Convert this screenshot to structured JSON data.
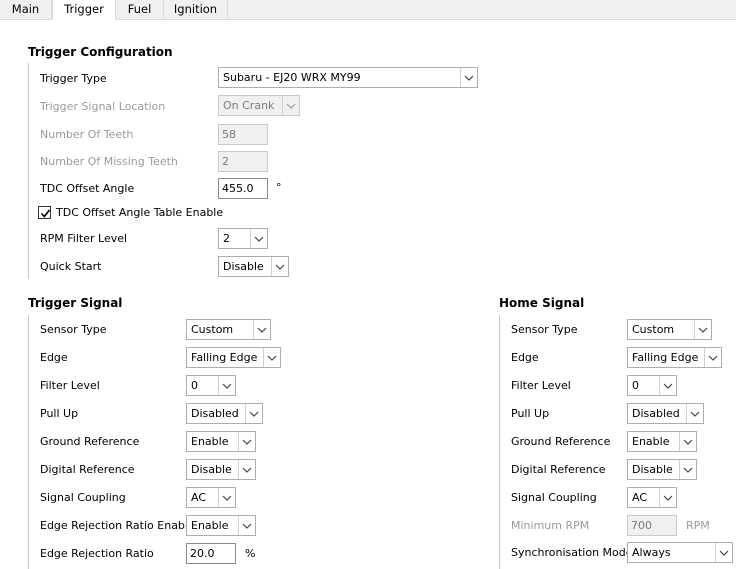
{
  "tabs": [
    "Main",
    "Trigger",
    "Fuel",
    "Ignition"
  ],
  "active_tab": "Trigger",
  "trigger_configuration": {
    "title": "Trigger Configuration",
    "trigger_type": {
      "label": "Trigger Type",
      "value": "Subaru - EJ20 WRX MY99"
    },
    "trigger_signal_location": {
      "label": "Trigger Signal Location",
      "value": "On Crank"
    },
    "number_of_teeth": {
      "label": "Number Of Teeth",
      "value": "58"
    },
    "number_of_missing_teeth": {
      "label": "Number Of Missing Teeth",
      "value": "2"
    },
    "tdc_offset_angle": {
      "label": "TDC Offset Angle",
      "value": "455.0",
      "unit": "°"
    },
    "tdc_offset_table_enable": {
      "label": "TDC Offset Angle Table Enable",
      "checked": true
    },
    "rpm_filter_level": {
      "label": "RPM Filter Level",
      "value": "2"
    },
    "quick_start": {
      "label": "Quick Start",
      "value": "Disable"
    }
  },
  "trigger_signal": {
    "title": "Trigger Signal",
    "sensor_type": {
      "label": "Sensor Type",
      "value": "Custom"
    },
    "edge": {
      "label": "Edge",
      "value": "Falling Edge"
    },
    "filter_level": {
      "label": "Filter Level",
      "value": "0"
    },
    "pull_up": {
      "label": "Pull Up",
      "value": "Disabled"
    },
    "ground_reference": {
      "label": "Ground Reference",
      "value": "Enable"
    },
    "digital_reference": {
      "label": "Digital Reference",
      "value": "Disable"
    },
    "signal_coupling": {
      "label": "Signal Coupling",
      "value": "AC"
    },
    "edge_rejection_enable": {
      "label": "Edge Rejection Ratio Enable",
      "value": "Enable"
    },
    "edge_rejection_ratio": {
      "label": "Edge Rejection Ratio",
      "value": "20.0",
      "unit": "%"
    }
  },
  "home_signal": {
    "title": "Home Signal",
    "sensor_type": {
      "label": "Sensor Type",
      "value": "Custom"
    },
    "edge": {
      "label": "Edge",
      "value": "Falling Edge"
    },
    "filter_level": {
      "label": "Filter Level",
      "value": "0"
    },
    "pull_up": {
      "label": "Pull Up",
      "value": "Disabled"
    },
    "ground_reference": {
      "label": "Ground Reference",
      "value": "Enable"
    },
    "digital_reference": {
      "label": "Digital Reference",
      "value": "Disable"
    },
    "signal_coupling": {
      "label": "Signal Coupling",
      "value": "AC"
    },
    "minimum_rpm": {
      "label": "Minimum RPM",
      "value": "700",
      "unit": "RPM"
    },
    "synchronisation_mode": {
      "label": "Synchronisation Mode",
      "value": "Always"
    }
  },
  "icons": {
    "dropdown": "chevron-down-icon",
    "check": "checkmark-icon"
  }
}
